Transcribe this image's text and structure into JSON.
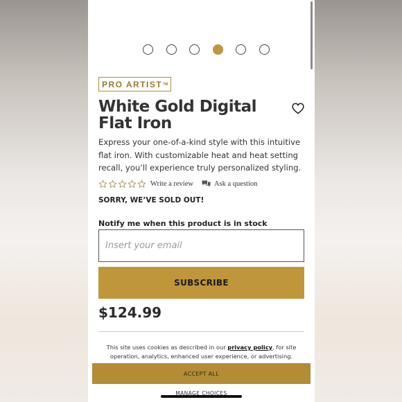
{
  "carousel": {
    "count": 6,
    "active_index": 3
  },
  "product": {
    "brand": "PRO ARTIST",
    "brand_tm": "TM",
    "title": "White Gold Digital Flat Iron",
    "description": "Express your one-of-a-kind style with this intuitive flat iron. With customizable heat and heat setting recall, you’ll experience truly personalized styling.",
    "rating_stars": 0,
    "write_review": "Write a review",
    "ask_question": "Ask a question",
    "stock_status": "SORRY, WE’VE SOLD OUT!",
    "price": "$124.99"
  },
  "notify": {
    "label": "Notify me when this product is in stock",
    "placeholder": "Insert your email",
    "subscribe_label": "SUBSCRIBE"
  },
  "cookie_banner": {
    "text_before": "This site uses cookies as described in our ",
    "link_text": "privacy policy",
    "text_after": ", for site operation, analytics, enhanced user experience, or advertising.",
    "accept_label": "ACCEPT ALL",
    "manage_label": "MANAGE CHOICES"
  },
  "colors": {
    "accent_gold": "#c0963a",
    "text_dark": "#333333"
  },
  "icons": {
    "favorite": "heart-outline-icon",
    "star": "star-outline-icon",
    "question": "chat-bubble-icon"
  }
}
